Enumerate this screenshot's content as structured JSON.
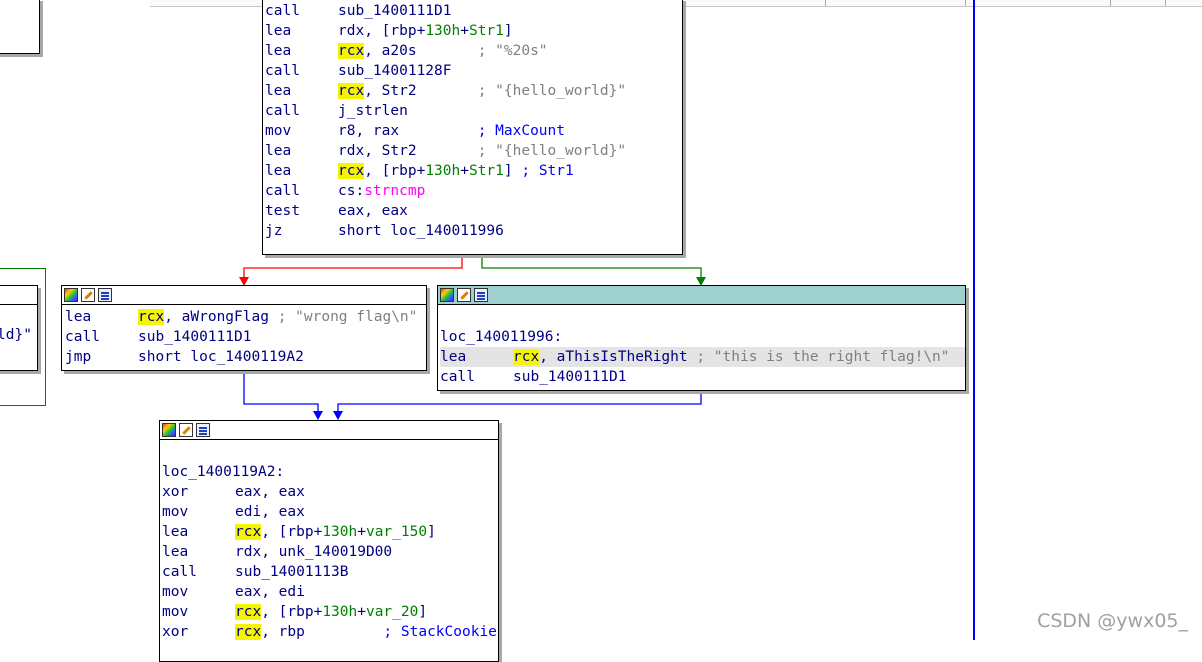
{
  "top_block": {
    "lines": [
      {
        "mnemonic": "call",
        "parts": [
          {
            "t": "sub_1400111D1"
          }
        ]
      },
      {
        "mnemonic": "lea",
        "parts": [
          {
            "t": "rdx, [rbp+"
          },
          {
            "t": "130h",
            "c": "grn"
          },
          {
            "t": "+"
          },
          {
            "t": "Str1",
            "c": "grn"
          },
          {
            "t": "]"
          }
        ]
      },
      {
        "mnemonic": "lea",
        "parts": [
          {
            "t": "rcx",
            "c": "r"
          },
          {
            "t": ", a20s       "
          },
          {
            "t": "; \"%20s\"",
            "c": "cmt"
          }
        ]
      },
      {
        "mnemonic": "call",
        "parts": [
          {
            "t": "sub_14001128F"
          }
        ]
      },
      {
        "mnemonic": "lea",
        "parts": [
          {
            "t": "rcx",
            "c": "r"
          },
          {
            "t": ", Str2       "
          },
          {
            "t": "; \"{hello_world}\"",
            "c": "cmt"
          }
        ]
      },
      {
        "mnemonic": "call",
        "parts": [
          {
            "t": "j_strlen"
          }
        ]
      },
      {
        "mnemonic": "mov",
        "parts": [
          {
            "t": "r8, rax         "
          },
          {
            "t": "; MaxCount",
            "c": "cmtb"
          }
        ]
      },
      {
        "mnemonic": "lea",
        "parts": [
          {
            "t": "rdx, Str2       "
          },
          {
            "t": "; \"{hello_world}\"",
            "c": "cmt"
          }
        ]
      },
      {
        "mnemonic": "lea",
        "parts": [
          {
            "t": "rcx",
            "c": "r"
          },
          {
            "t": ", [rbp+"
          },
          {
            "t": "130h",
            "c": "grn"
          },
          {
            "t": "+"
          },
          {
            "t": "Str1",
            "c": "grn"
          },
          {
            "t": "] "
          },
          {
            "t": "; Str1",
            "c": "cmtb"
          }
        ]
      },
      {
        "mnemonic": "call",
        "parts": [
          {
            "t": "cs:"
          },
          {
            "t": "strncmp",
            "c": "mag"
          }
        ]
      },
      {
        "mnemonic": "test",
        "parts": [
          {
            "t": "eax, eax"
          }
        ]
      },
      {
        "mnemonic": "jz",
        "parts": [
          {
            "t": "short loc_140011996"
          }
        ]
      }
    ]
  },
  "wrong_block": {
    "lines": [
      {
        "mnemonic": "lea",
        "parts": [
          {
            "t": "rcx",
            "c": "r"
          },
          {
            "t": ", aWrongFlag "
          },
          {
            "t": "; \"wrong flag\\n\"",
            "c": "cmt"
          }
        ]
      },
      {
        "mnemonic": "call",
        "parts": [
          {
            "t": "sub_1400111D1"
          }
        ]
      },
      {
        "mnemonic": "jmp",
        "parts": [
          {
            "t": "short loc_1400119A2"
          }
        ]
      }
    ]
  },
  "right_block": {
    "lines": [
      {
        "mnemonic": "",
        "parts": []
      },
      {
        "label": "loc_140011996:"
      },
      {
        "mnemonic": "lea",
        "hl": true,
        "parts": [
          {
            "t": "rcx",
            "c": "r"
          },
          {
            "t": ", aThisIsTheRight "
          },
          {
            "t": "; \"this is the right flag!\\n\"",
            "c": "cmt"
          }
        ]
      },
      {
        "mnemonic": "call",
        "parts": [
          {
            "t": "sub_1400111D1"
          }
        ]
      }
    ]
  },
  "bottom_block": {
    "lines": [
      {
        "mnemonic": "",
        "parts": []
      },
      {
        "label": "loc_1400119A2:"
      },
      {
        "mnemonic": "xor",
        "parts": [
          {
            "t": "eax, eax"
          }
        ]
      },
      {
        "mnemonic": "mov",
        "parts": [
          {
            "t": "edi, eax"
          }
        ]
      },
      {
        "mnemonic": "lea",
        "parts": [
          {
            "t": "rcx",
            "c": "r"
          },
          {
            "t": ", [rbp+"
          },
          {
            "t": "130h",
            "c": "grn"
          },
          {
            "t": "+"
          },
          {
            "t": "var_150",
            "c": "grn"
          },
          {
            "t": "]"
          }
        ]
      },
      {
        "mnemonic": "lea",
        "parts": [
          {
            "t": "rdx, unk_140019D00"
          }
        ]
      },
      {
        "mnemonic": "call",
        "parts": [
          {
            "t": "sub_14001113B"
          }
        ]
      },
      {
        "mnemonic": "mov",
        "parts": [
          {
            "t": "eax, edi"
          }
        ]
      },
      {
        "mnemonic": "mov",
        "parts": [
          {
            "t": "rcx",
            "c": "r"
          },
          {
            "t": ", [rbp+"
          },
          {
            "t": "130h",
            "c": "grn"
          },
          {
            "t": "+"
          },
          {
            "t": "var_20",
            "c": "grn"
          },
          {
            "t": "]"
          }
        ]
      },
      {
        "mnemonic": "xor",
        "parts": [
          {
            "t": "rcx",
            "c": "r"
          },
          {
            "t": ", rbp         "
          },
          {
            "t": "; StackCookie",
            "c": "cmtb"
          }
        ]
      }
    ]
  },
  "left_partial": {
    "text": "ld}\""
  },
  "watermark": "CSDN @ywx05_",
  "colors": {
    "false_edge": "#ff0000",
    "true_edge": "#008000",
    "jump_edge": "#0000ff",
    "header_teal": "#9fd0d0",
    "reg_highlight": "#f5f500"
  }
}
